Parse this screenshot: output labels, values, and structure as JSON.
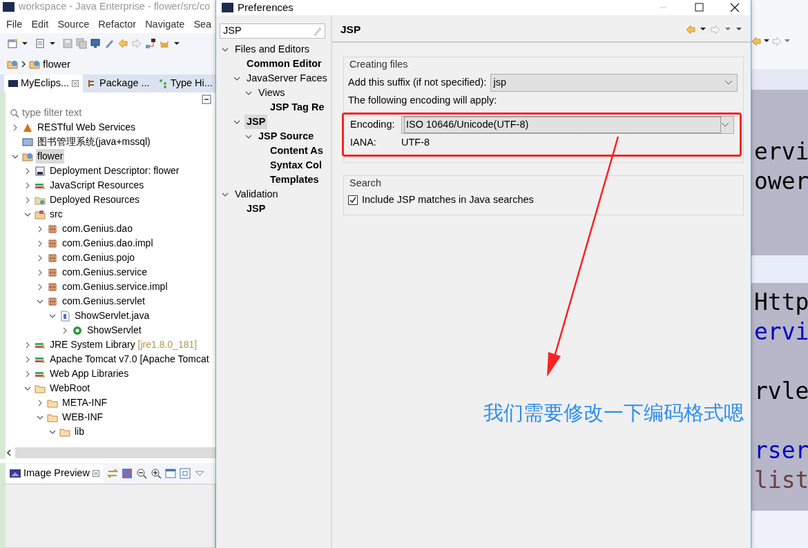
{
  "ide": {
    "title": "workspace - Java Enterprise - flower/src/co",
    "menu": [
      "File",
      "Edit",
      "Source",
      "Refactor",
      "Navigate",
      "Sea"
    ],
    "breadcrumb": "flower",
    "tabs": [
      {
        "label": "MyEclips...",
        "selected": true
      },
      {
        "label": "Package ...",
        "selected": false
      },
      {
        "label": "Type Hi...",
        "selected": false
      }
    ],
    "filter": {
      "placeholder": "type filter text"
    },
    "tree": [
      {
        "label": "RESTful Web Services",
        "kind": "rest",
        "expanded": false,
        "selected": false
      },
      {
        "label": "图书管理系统(java+mssql)",
        "kind": "closed",
        "selected": false
      },
      {
        "label": "flower",
        "kind": "project",
        "expanded": true,
        "selected": true,
        "children": [
          {
            "label": "Deployment Descriptor: flower",
            "kind": "descriptor",
            "expanded": false,
            "selected": false
          },
          {
            "label": "JavaScript Resources",
            "kind": "library",
            "expanded": false,
            "selected": false
          },
          {
            "label": "Deployed Resources",
            "kind": "deployed",
            "expanded": false,
            "selected": false
          },
          {
            "label": "src",
            "kind": "source",
            "expanded": true,
            "selected": false,
            "children": [
              {
                "label": "com.Genius.dao",
                "kind": "package",
                "expanded": false,
                "selected": false
              },
              {
                "label": "com.Genius.dao.impl",
                "kind": "package",
                "expanded": false,
                "selected": false
              },
              {
                "label": "com.Genius.pojo",
                "kind": "package",
                "expanded": false,
                "selected": false
              },
              {
                "label": "com.Genius.service",
                "kind": "package",
                "expanded": false,
                "selected": false
              },
              {
                "label": "com.Genius.service.impl",
                "kind": "package",
                "expanded": false,
                "selected": false
              },
              {
                "label": "com.Genius.servlet",
                "kind": "package",
                "expanded": true,
                "selected": false,
                "children": [
                  {
                    "label": "ShowServlet.java",
                    "kind": "file",
                    "expanded": true,
                    "selected": false,
                    "children": [
                      {
                        "label": "ShowServlet",
                        "kind": "class",
                        "expanded": false,
                        "selected": false
                      }
                    ]
                  }
                ]
              }
            ]
          },
          {
            "label": "JRE System Library",
            "decoration": "[jre1.8.0_181]",
            "kind": "library",
            "expanded": false,
            "selected": false
          },
          {
            "label": "Apache Tomcat v7.0 [Apache Tomcat",
            "kind": "library",
            "expanded": false,
            "selected": false
          },
          {
            "label": "Web App Libraries",
            "kind": "library",
            "expanded": false,
            "selected": false
          },
          {
            "label": "WebRoot",
            "kind": "folder",
            "expanded": true,
            "selected": false,
            "children": [
              {
                "label": "META-INF",
                "kind": "folder",
                "expanded": false,
                "selected": false
              },
              {
                "label": "WEB-INF",
                "kind": "folder",
                "expanded": true,
                "selected": false,
                "children": [
                  {
                    "label": "lib",
                    "kind": "folder",
                    "expanded": true,
                    "selected": false
                  }
                ]
              }
            ]
          }
        ]
      }
    ],
    "preview": {
      "title": "Image Preview",
      "selected": true
    }
  },
  "dialog": {
    "title": "Preferences",
    "filter": "JSP",
    "tree": [
      {
        "label": "Files and Editors",
        "matched": false,
        "expanded": true,
        "selected": false,
        "children": [
          {
            "label": "Common Editor",
            "matched": true,
            "selected": false
          },
          {
            "label": "JavaServer Faces",
            "matched": false,
            "expanded": true,
            "selected": false,
            "children": [
              {
                "label": "Views",
                "matched": false,
                "expanded": true,
                "selected": false,
                "children": [
                  {
                    "label": "JSP Tag Re",
                    "matched": true,
                    "selected": false
                  }
                ]
              }
            ]
          },
          {
            "label": "JSP",
            "matched": true,
            "expanded": true,
            "selected": true,
            "children": [
              {
                "label": "JSP Source",
                "matched": true,
                "expanded": true,
                "selected": false,
                "children": [
                  {
                    "label": "Content As",
                    "matched": true,
                    "selected": false
                  },
                  {
                    "label": "Syntax Col",
                    "matched": true,
                    "selected": false
                  },
                  {
                    "label": "Templates",
                    "matched": true,
                    "selected": false
                  }
                ]
              }
            ]
          }
        ]
      },
      {
        "label": "Validation",
        "matched": false,
        "expanded": true,
        "selected": false,
        "children": [
          {
            "label": "JSP",
            "matched": true,
            "selected": false
          }
        ]
      }
    ],
    "page_title": "JSP",
    "creating_files": {
      "legend": "Creating files",
      "suffix_label": "Add this suffix (if not specified):",
      "suffix_value": "jsp",
      "encoding_note": "The following encoding will apply:",
      "encoding_label": "Encoding:",
      "encoding_value": "ISO 10646/Unicode(UTF-8)",
      "iana_label": "IANA:",
      "iana_value": "UTF-8"
    },
    "search": {
      "legend": "Search",
      "option": {
        "label": "Include JSP matches in Java searches",
        "checked": true
      }
    }
  },
  "editor": {
    "blocks": [
      [
        {
          "text": "ervi",
          "kind": "plain"
        },
        {
          "text": "ower",
          "kind": "plain"
        }
      ],
      [
        {
          "text": "Http",
          "kind": "plain"
        },
        {
          "text": "ervi",
          "kind": "field"
        },
        {
          "kind": "blank"
        },
        {
          "text": "rvle",
          "kind": "plain"
        },
        {
          "kind": "blank"
        },
        {
          "text": "rser",
          "kind": "field"
        },
        {
          "text": "list",
          "kind": "variable"
        }
      ]
    ]
  },
  "annotation": {
    "text": "我们需要修改一下编码格式嗯"
  }
}
